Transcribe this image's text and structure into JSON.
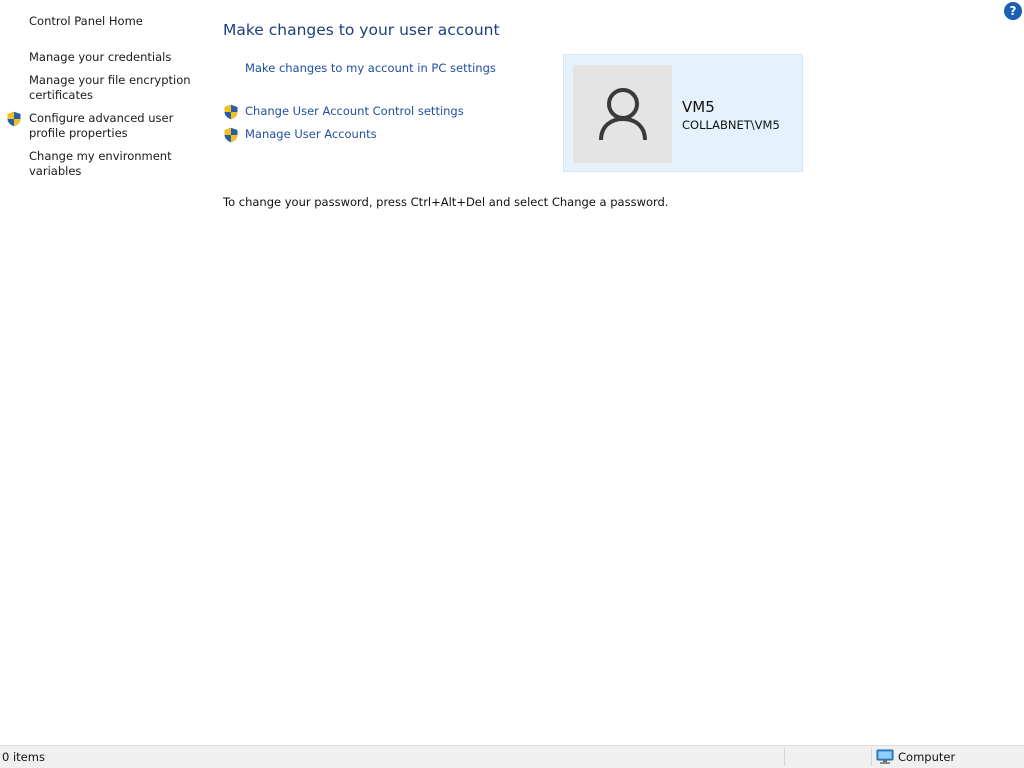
{
  "left_pane": {
    "control_panel_home": "Control Panel Home",
    "items": [
      {
        "label": "Manage your credentials",
        "icon": ""
      },
      {
        "label": "Manage your file encryption certificates",
        "icon": ""
      },
      {
        "label": "Configure advanced user profile properties",
        "icon": "uac-shield-icon"
      },
      {
        "label": "Change my environment variables",
        "icon": ""
      }
    ]
  },
  "main": {
    "title": "Make changes to your user account",
    "links": [
      {
        "label": "Make changes to my account in PC settings",
        "icon": ""
      },
      {
        "label": "Change User Account Control settings",
        "icon": "uac-shield-icon"
      },
      {
        "label": "Manage User Accounts",
        "icon": "uac-shield-icon"
      }
    ],
    "account": {
      "name": "VM5",
      "domain_user": "COLLABNET\\VM5"
    },
    "info_text": "To change your password, press Ctrl+Alt+Del and select Change a password."
  },
  "status_bar": {
    "items_count": "0 items",
    "location": "Computer",
    "location_icon": "computer-icon"
  },
  "help": {
    "label": "?"
  },
  "colors": {
    "link": "#1f4e9e",
    "title": "#1e3f80",
    "card_bg": "#e5f1fb",
    "avatar_bg": "#e4e4e4",
    "status_bg": "#f0f0f0"
  }
}
